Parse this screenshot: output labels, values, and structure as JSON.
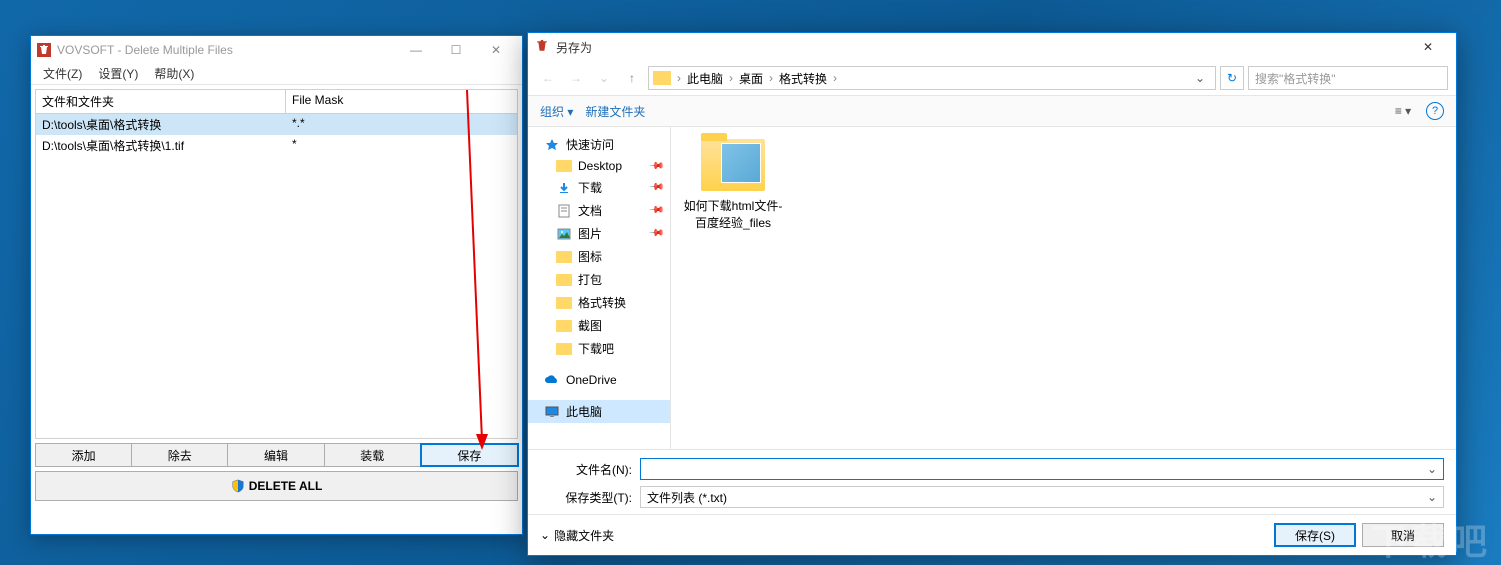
{
  "app": {
    "title": "VOVSOFT - Delete Multiple Files",
    "menu": {
      "file": "文件(Z)",
      "settings": "设置(Y)",
      "help": "帮助(X)"
    },
    "columns": {
      "path": "文件和文件夹",
      "mask": "File Mask"
    },
    "rows": [
      {
        "path": "D:\\tools\\桌面\\格式转换",
        "mask": "*.*"
      },
      {
        "path": "D:\\tools\\桌面\\格式转换\\1.tif",
        "mask": "*"
      }
    ],
    "buttons": {
      "add": "添加",
      "remove": "除去",
      "edit": "编辑",
      "load": "装载",
      "save": "保存"
    },
    "delete_all": "DELETE ALL"
  },
  "dialog": {
    "title": "另存为",
    "breadcrumb": [
      "此电脑",
      "桌面",
      "格式转换"
    ],
    "search_placeholder": "搜索\"格式转换\"",
    "toolbar": {
      "organize": "组织",
      "new_folder": "新建文件夹"
    },
    "nav": {
      "quick_access": "快速访问",
      "items": [
        "Desktop",
        "下载",
        "文档",
        "图片",
        "图标",
        "打包",
        "格式转换",
        "截图",
        "下载吧"
      ],
      "onedrive": "OneDrive",
      "this_pc": "此电脑"
    },
    "content_item": "如何下载html文件-百度经验_files",
    "form": {
      "filename_label": "文件名(N):",
      "filename_value": "",
      "type_label": "保存类型(T):",
      "type_value": "文件列表 (*.txt)"
    },
    "footer": {
      "hide_folders": "隐藏文件夹",
      "save": "保存(S)",
      "cancel": "取消"
    }
  },
  "watermark": "下载吧"
}
